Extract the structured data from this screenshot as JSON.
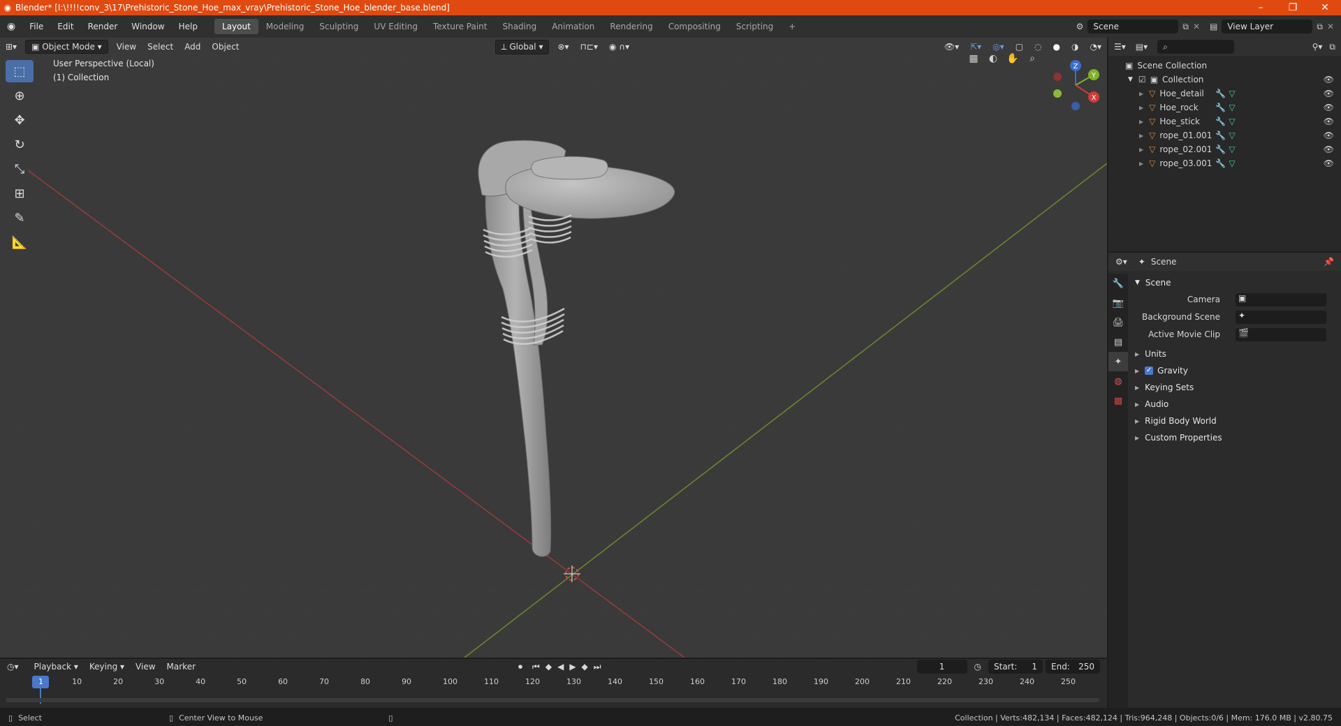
{
  "window": {
    "title": "Blender* [I:\\!!!!conv_3\\17\\Prehistoric_Stone_Hoe_max_vray\\Prehistoric_Stone_Hoe_blender_base.blend]",
    "accent": "#e04a10"
  },
  "menus": [
    "File",
    "Edit",
    "Render",
    "Window",
    "Help"
  ],
  "workspaces": [
    "Layout",
    "Modeling",
    "Sculpting",
    "UV Editing",
    "Texture Paint",
    "Shading",
    "Animation",
    "Rendering",
    "Compositing",
    "Scripting"
  ],
  "scene_field": "Scene",
  "view_layer_field": "View Layer",
  "viewport": {
    "mode": "Object Mode",
    "menus": [
      "View",
      "Select",
      "Add",
      "Object"
    ],
    "orientation": "Global",
    "info_line1": "User Perspective (Local)",
    "info_line2": "(1) Collection",
    "gizmo_axes": {
      "x": "X",
      "y": "Y",
      "z": "Z"
    }
  },
  "outliner": {
    "root": "Scene Collection",
    "collection": "Collection",
    "items": [
      "Hoe_detail",
      "Hoe_rock",
      "Hoe_stick",
      "rope_01.001",
      "rope_02.001",
      "rope_03.001"
    ]
  },
  "properties": {
    "header": "Scene",
    "panel": "Scene",
    "camera_label": "Camera",
    "bg_scene_label": "Background Scene",
    "movie_clip_label": "Active Movie Clip",
    "subpanels": [
      "Units",
      "Gravity",
      "Keying Sets",
      "Audio",
      "Rigid Body World",
      "Custom Properties"
    ]
  },
  "timeline": {
    "menus": [
      "Playback",
      "Keying",
      "View",
      "Marker"
    ],
    "current_frame": "1",
    "start_label": "Start:",
    "start": "1",
    "end_label": "End:",
    "end": "250",
    "ticks": [
      "1",
      "10",
      "20",
      "30",
      "40",
      "50",
      "60",
      "70",
      "80",
      "90",
      "100",
      "110",
      "120",
      "130",
      "140",
      "150",
      "160",
      "170",
      "180",
      "190",
      "200",
      "210",
      "220",
      "230",
      "240",
      "250"
    ]
  },
  "status": {
    "left": "Select",
    "middle": "Center View to Mouse",
    "right": "Collection | Verts:482,134 | Faces:482,124 | Tris:964,248 | Objects:0/6 | Mem: 176.0 MB | v2.80.75"
  }
}
